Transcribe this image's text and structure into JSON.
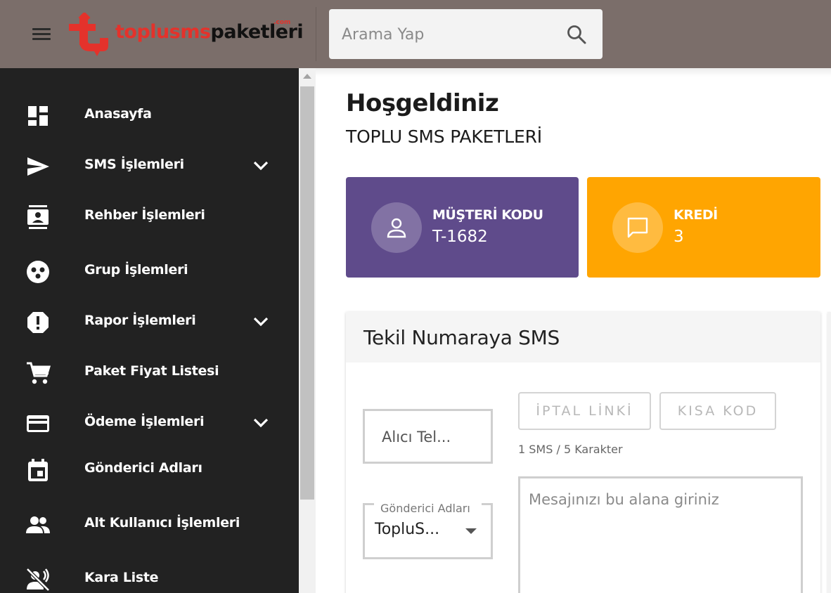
{
  "header": {
    "logo": {
      "part1": "toplusms",
      "part2": "paketleri",
      "suffix": ".com"
    },
    "search": {
      "placeholder": "Arama Yap"
    }
  },
  "sidebar": {
    "items": [
      {
        "label": "Anasayfa",
        "icon": "dashboard-icon",
        "expandable": false
      },
      {
        "label": "SMS İşlemleri",
        "icon": "send-icon",
        "expandable": true
      },
      {
        "label": "Rehber İşlemleri",
        "icon": "contacts-icon",
        "expandable": false
      },
      {
        "label": "Grup İşlemleri",
        "icon": "group-icon",
        "expandable": false
      },
      {
        "label": "Rapor İşlemleri",
        "icon": "report-icon",
        "expandable": true
      },
      {
        "label": "Paket Fiyat Listesi",
        "icon": "cart-icon",
        "expandable": false
      },
      {
        "label": "Ödeme İşlemleri",
        "icon": "credit-card-icon",
        "expandable": true
      },
      {
        "label": "Gönderici Adları",
        "icon": "calendar-icon",
        "expandable": false
      },
      {
        "label": "Alt Kullanıcı İşlemleri",
        "icon": "people-icon",
        "expandable": false
      },
      {
        "label": "Kara Liste",
        "icon": "voice-off-icon",
        "expandable": false
      }
    ]
  },
  "main": {
    "title": "Hoşgeldiniz",
    "subtitle": "TOPLU SMS PAKETLERİ",
    "cards": [
      {
        "label": "MÜŞTERİ KODU",
        "value": "T-1682",
        "color": "#5f4b8b",
        "icon": "person-icon"
      },
      {
        "label": "KREDİ",
        "value": "3",
        "color": "#ffa501",
        "icon": "chat-icon"
      }
    ],
    "sms_panel": {
      "title": "Tekil Numaraya SMS",
      "phone_placeholder": "Alıcı Tel...",
      "sender_label": "Gönderici Adları",
      "sender_value": "TopluS...",
      "buttons": {
        "cancel_link": "İPTAL LİNKİ",
        "short_code": "KISA KOD"
      },
      "char_count": "1 SMS / 5 Karakter",
      "message_placeholder": "Mesajınızı bu alana giriniz"
    }
  },
  "colors": {
    "header_bg": "#7b6e6a",
    "sidebar_bg": "#222222",
    "brand_red": "#e4322b",
    "card_purple": "#5f4b8b",
    "card_orange": "#ffa501"
  }
}
